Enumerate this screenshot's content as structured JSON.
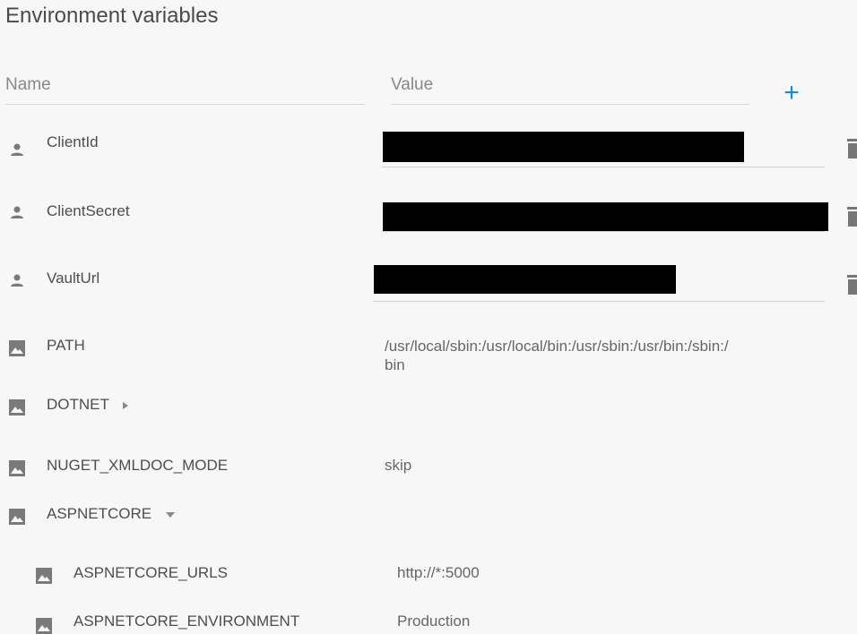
{
  "page": {
    "title": "Environment variables"
  },
  "columns": {
    "name": "Name",
    "value": "Value"
  },
  "add_button": "+",
  "user_vars": [
    {
      "name": "ClientId"
    },
    {
      "name": "ClientSecret"
    },
    {
      "name": "VaultUrl"
    }
  ],
  "system_vars": [
    {
      "name": "PATH",
      "value": "/usr/local/sbin:/usr/local/bin:/usr/sbin:/usr/bin:/sbin:/\nbin"
    },
    {
      "name": "DOTNET",
      "value": "",
      "group": "collapsed"
    },
    {
      "name": "NUGET_XMLDOC_MODE",
      "value": "skip"
    },
    {
      "name": "ASPNETCORE",
      "value": "",
      "group": "expanded"
    }
  ],
  "aspnetcore_children": [
    {
      "name": "ASPNETCORE_URLS",
      "value": "http://*:5000"
    },
    {
      "name": "ASPNETCORE_ENVIRONMENT",
      "value": "Production"
    }
  ],
  "colors": {
    "accent": "#1a8ad4",
    "icon": "#7a7a7a",
    "redaction": "#000000"
  }
}
